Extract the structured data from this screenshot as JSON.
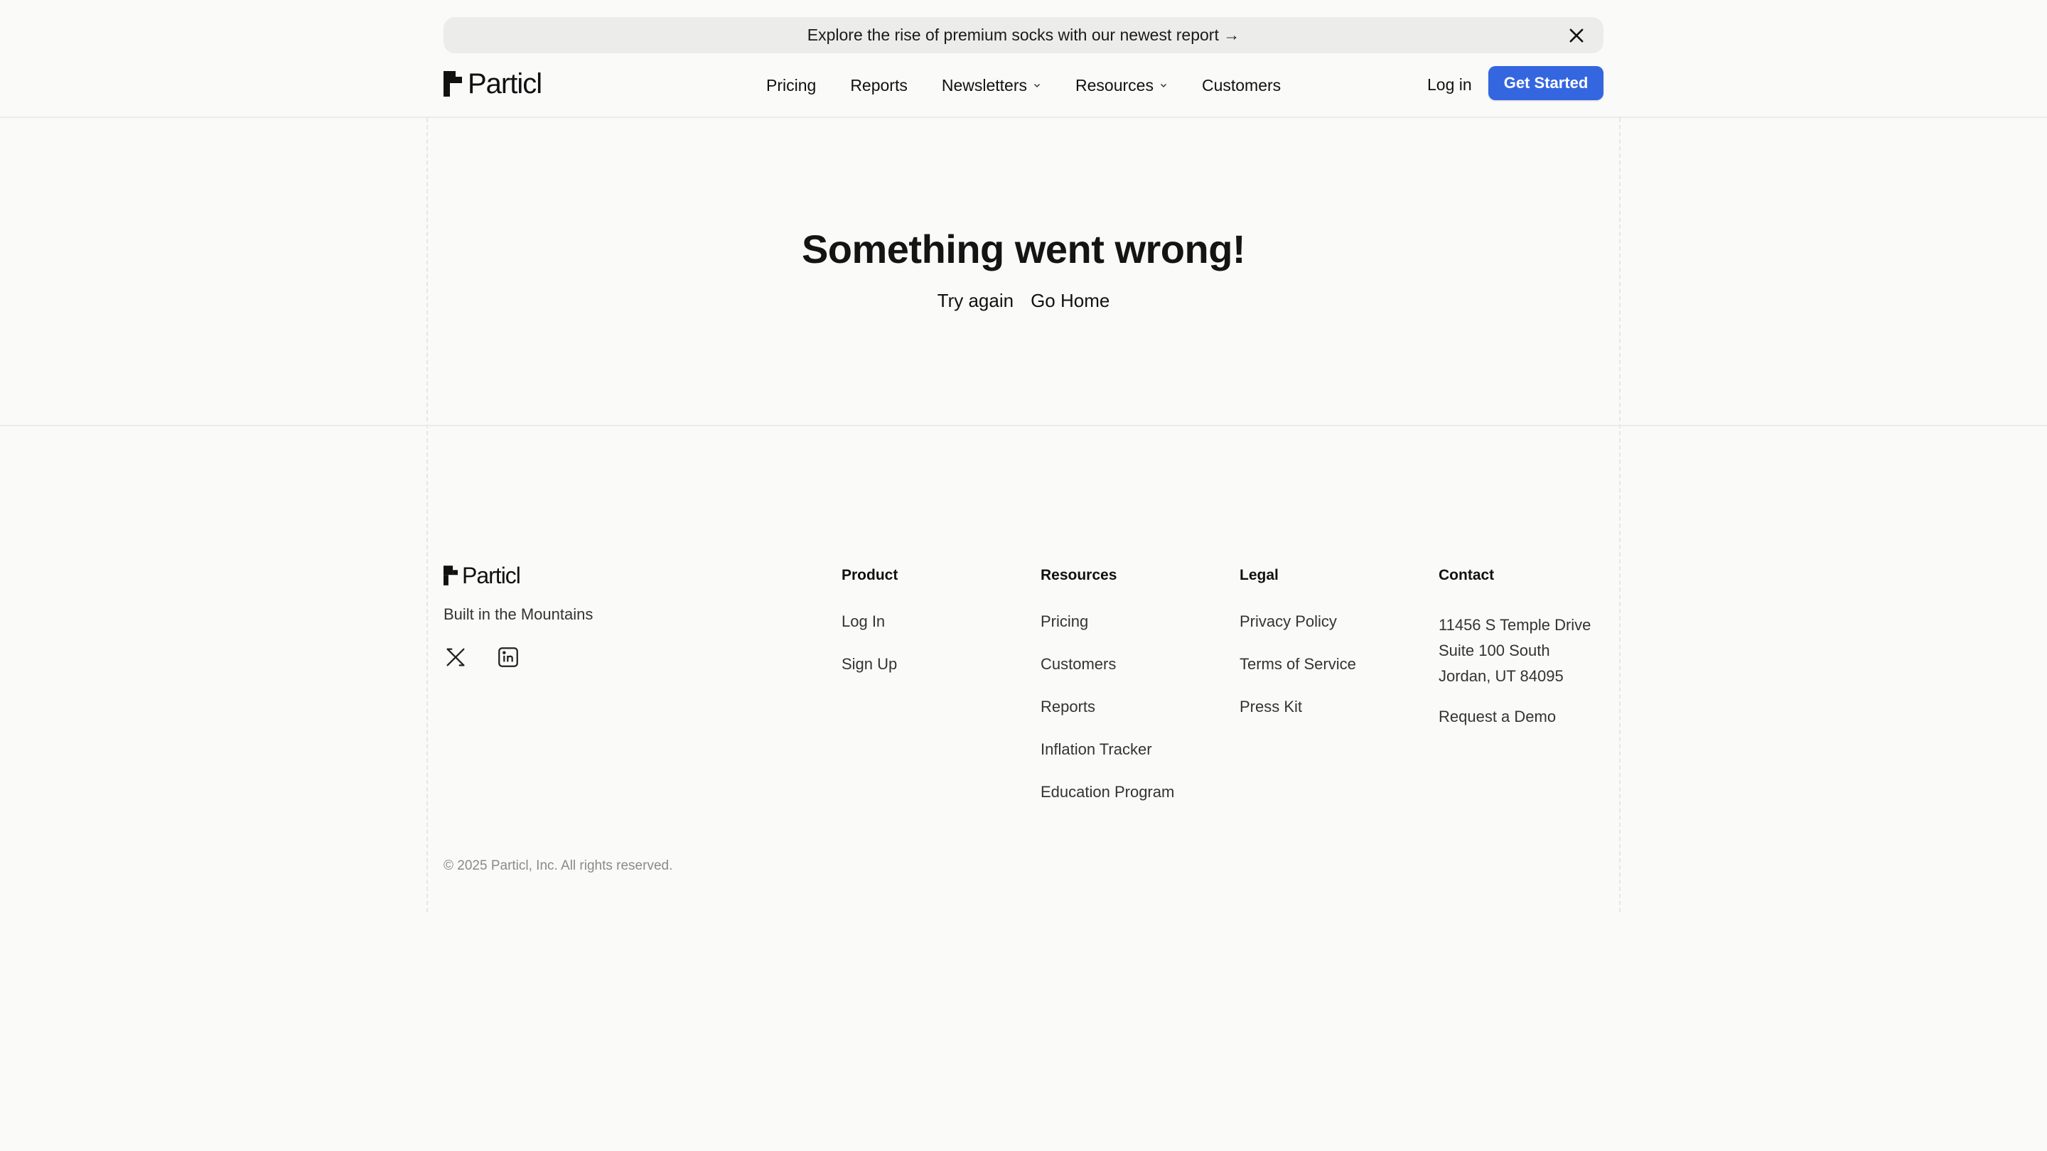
{
  "banner": {
    "text": "Explore the rise of premium socks with our newest report →",
    "close_icon": "close-icon"
  },
  "header": {
    "logo_text": "Particl",
    "nav": [
      {
        "label": "Pricing",
        "has_dropdown": false
      },
      {
        "label": "Reports",
        "has_dropdown": false
      },
      {
        "label": "Newsletters",
        "has_dropdown": true
      },
      {
        "label": "Resources",
        "has_dropdown": true
      },
      {
        "label": "Customers",
        "has_dropdown": false
      }
    ],
    "login_label": "Log in",
    "cta_label": "Get Started"
  },
  "error": {
    "title": "Something went wrong!",
    "try_again_label": "Try again",
    "go_home_label": "Go Home"
  },
  "footer": {
    "logo_text": "Particl",
    "tagline": "Built in the Mountains",
    "socials": [
      "x-icon",
      "linkedin-icon"
    ],
    "columns": {
      "product": {
        "title": "Product",
        "links": [
          "Log In",
          "Sign Up"
        ]
      },
      "resources": {
        "title": "Resources",
        "links": [
          "Pricing",
          "Customers",
          "Reports",
          "Inflation Tracker",
          "Education Program"
        ]
      },
      "legal": {
        "title": "Legal",
        "links": [
          "Privacy Policy",
          "Terms of Service",
          "Press Kit"
        ]
      },
      "contact": {
        "title": "Contact",
        "address": [
          "11456 S Temple Drive",
          "Suite 100 South",
          "Jordan, UT 84095"
        ],
        "demo_label": "Request a Demo"
      }
    },
    "copyright": "© 2025 Particl, Inc. All rights reserved."
  },
  "colors": {
    "background": "#fafaf9",
    "banner_bg": "#ececeb",
    "accent": "#3466e0",
    "text": "#111111",
    "muted": "#8a8a8a"
  }
}
